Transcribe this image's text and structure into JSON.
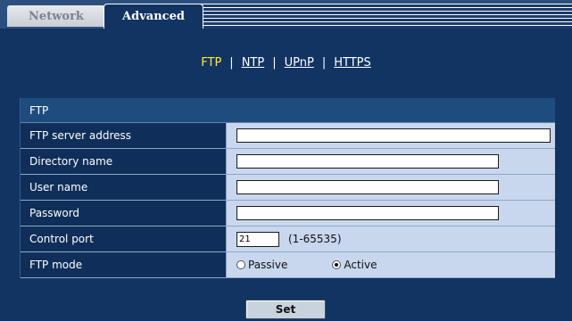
{
  "tabs": {
    "network": "Network",
    "advanced": "Advanced"
  },
  "subnav": {
    "ftp": "FTP",
    "ntp": "NTP",
    "upnp": "UPnP",
    "https": "HTTPS",
    "separator": "|"
  },
  "form": {
    "section_title": "FTP",
    "server_address_label": "FTP server address",
    "server_address_value": "",
    "directory_label": "Directory name",
    "directory_value": "",
    "user_label": "User name",
    "user_value": "",
    "password_label": "Password",
    "password_value": "",
    "port_label": "Control port",
    "port_value": "21",
    "port_hint": "(1-65535)",
    "mode_label": "FTP mode",
    "mode_passive": "Passive",
    "mode_active": "Active",
    "mode_selected": "Active"
  },
  "buttons": {
    "set": "Set"
  },
  "colors": {
    "background": "#113463",
    "active_link": "#ffea3c",
    "label_cell": "#0f2f5a",
    "value_cell": "#c8d7ee"
  }
}
